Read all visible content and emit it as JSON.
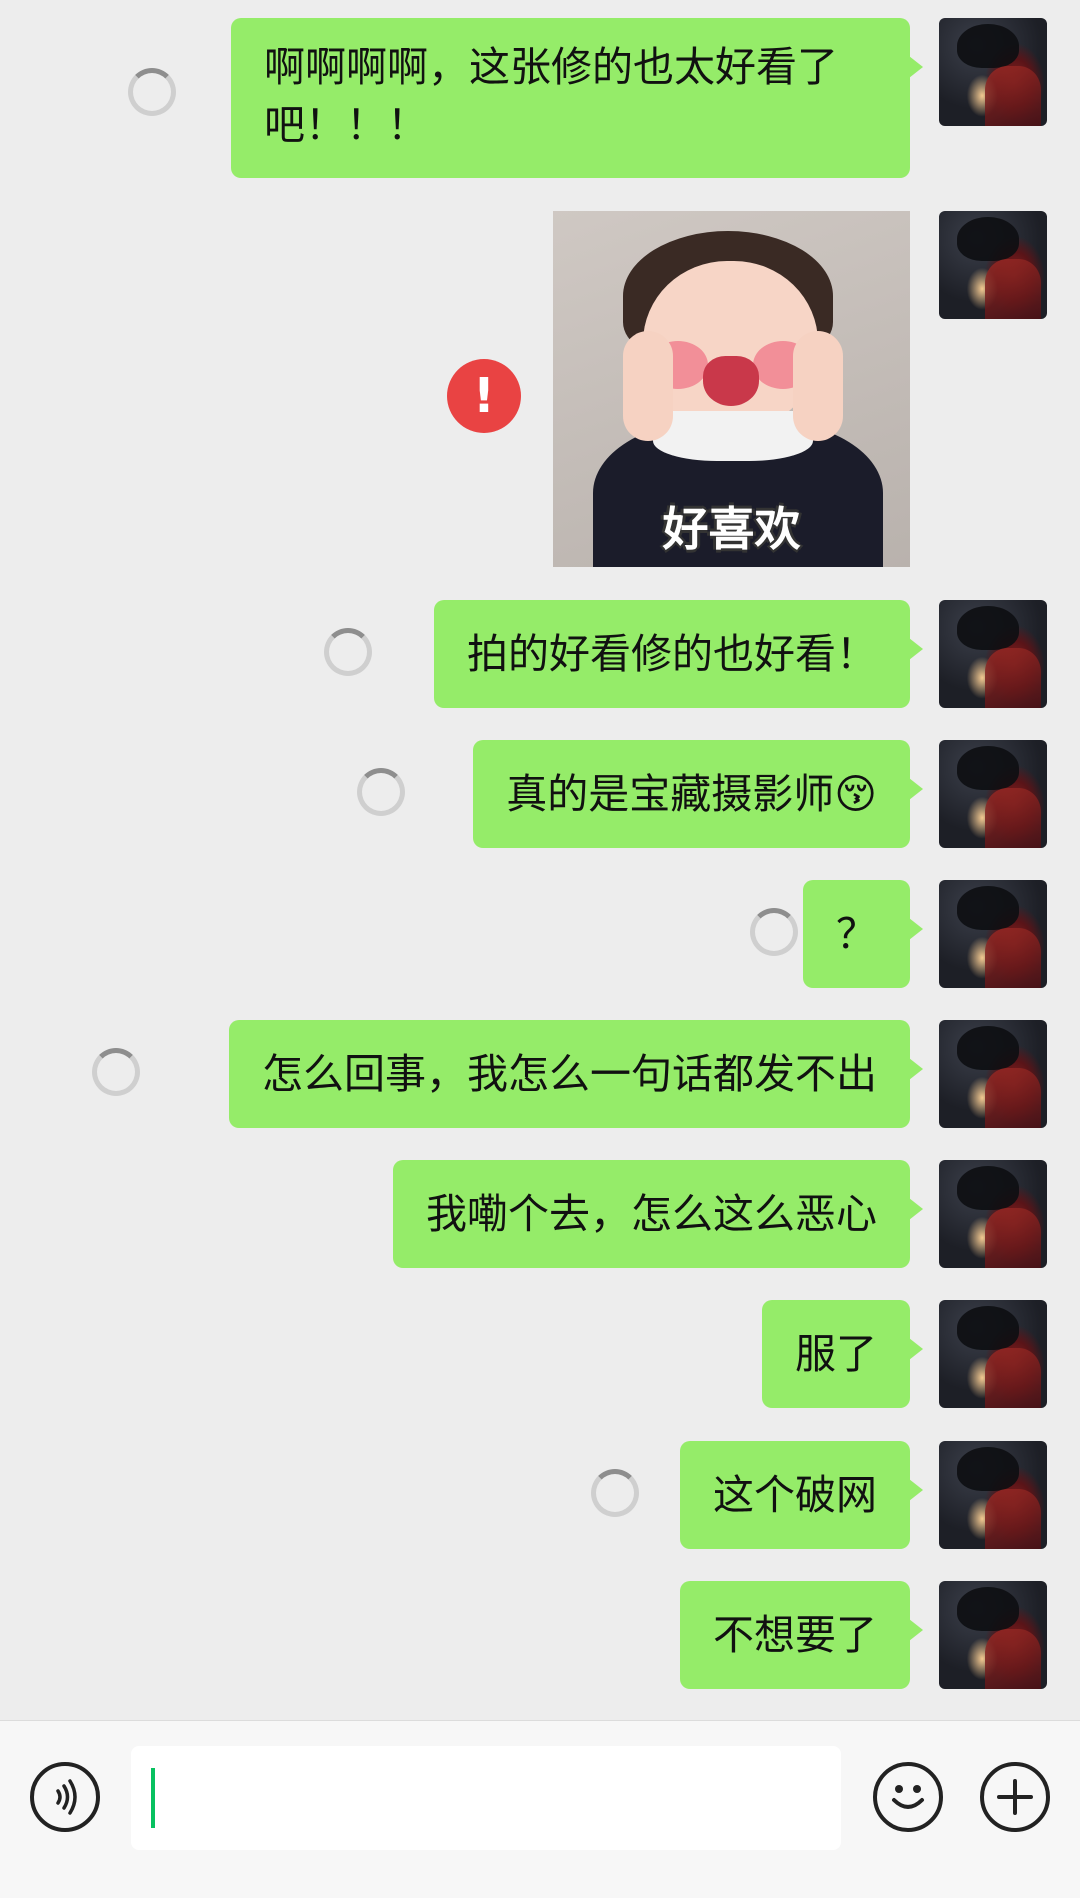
{
  "messages": [
    {
      "type": "text",
      "text": "啊啊啊啊，这张修的也太好看了吧！！！",
      "status": "sending"
    },
    {
      "type": "sticker",
      "caption": "好喜欢",
      "status": "failed"
    },
    {
      "type": "text",
      "text": "拍的好看修的也好看！",
      "status": "sending"
    },
    {
      "type": "text",
      "text": "真的是宝藏摄影师😚",
      "status": "sending"
    },
    {
      "type": "text",
      "text": "？",
      "status": "sending"
    },
    {
      "type": "text",
      "text": "怎么回事，我怎么一句话都发不出",
      "status": "sending"
    },
    {
      "type": "text",
      "text": "我嘞个去，怎么这么恶心",
      "status": "sent"
    },
    {
      "type": "text",
      "text": "服了",
      "status": "sent"
    },
    {
      "type": "text",
      "text": "这个破网",
      "status": "sending"
    },
    {
      "type": "text",
      "text": "不想要了",
      "status": "sent"
    }
  ],
  "icons": {
    "failed": "exclamation-icon",
    "voice": "voice-icon",
    "emoji": "emoji-icon",
    "more": "plus-icon"
  },
  "input": {
    "value": ""
  },
  "colors": {
    "bubble": "#95ec69",
    "background": "#ededed",
    "error": "#e94343",
    "cursor": "#07c160"
  }
}
